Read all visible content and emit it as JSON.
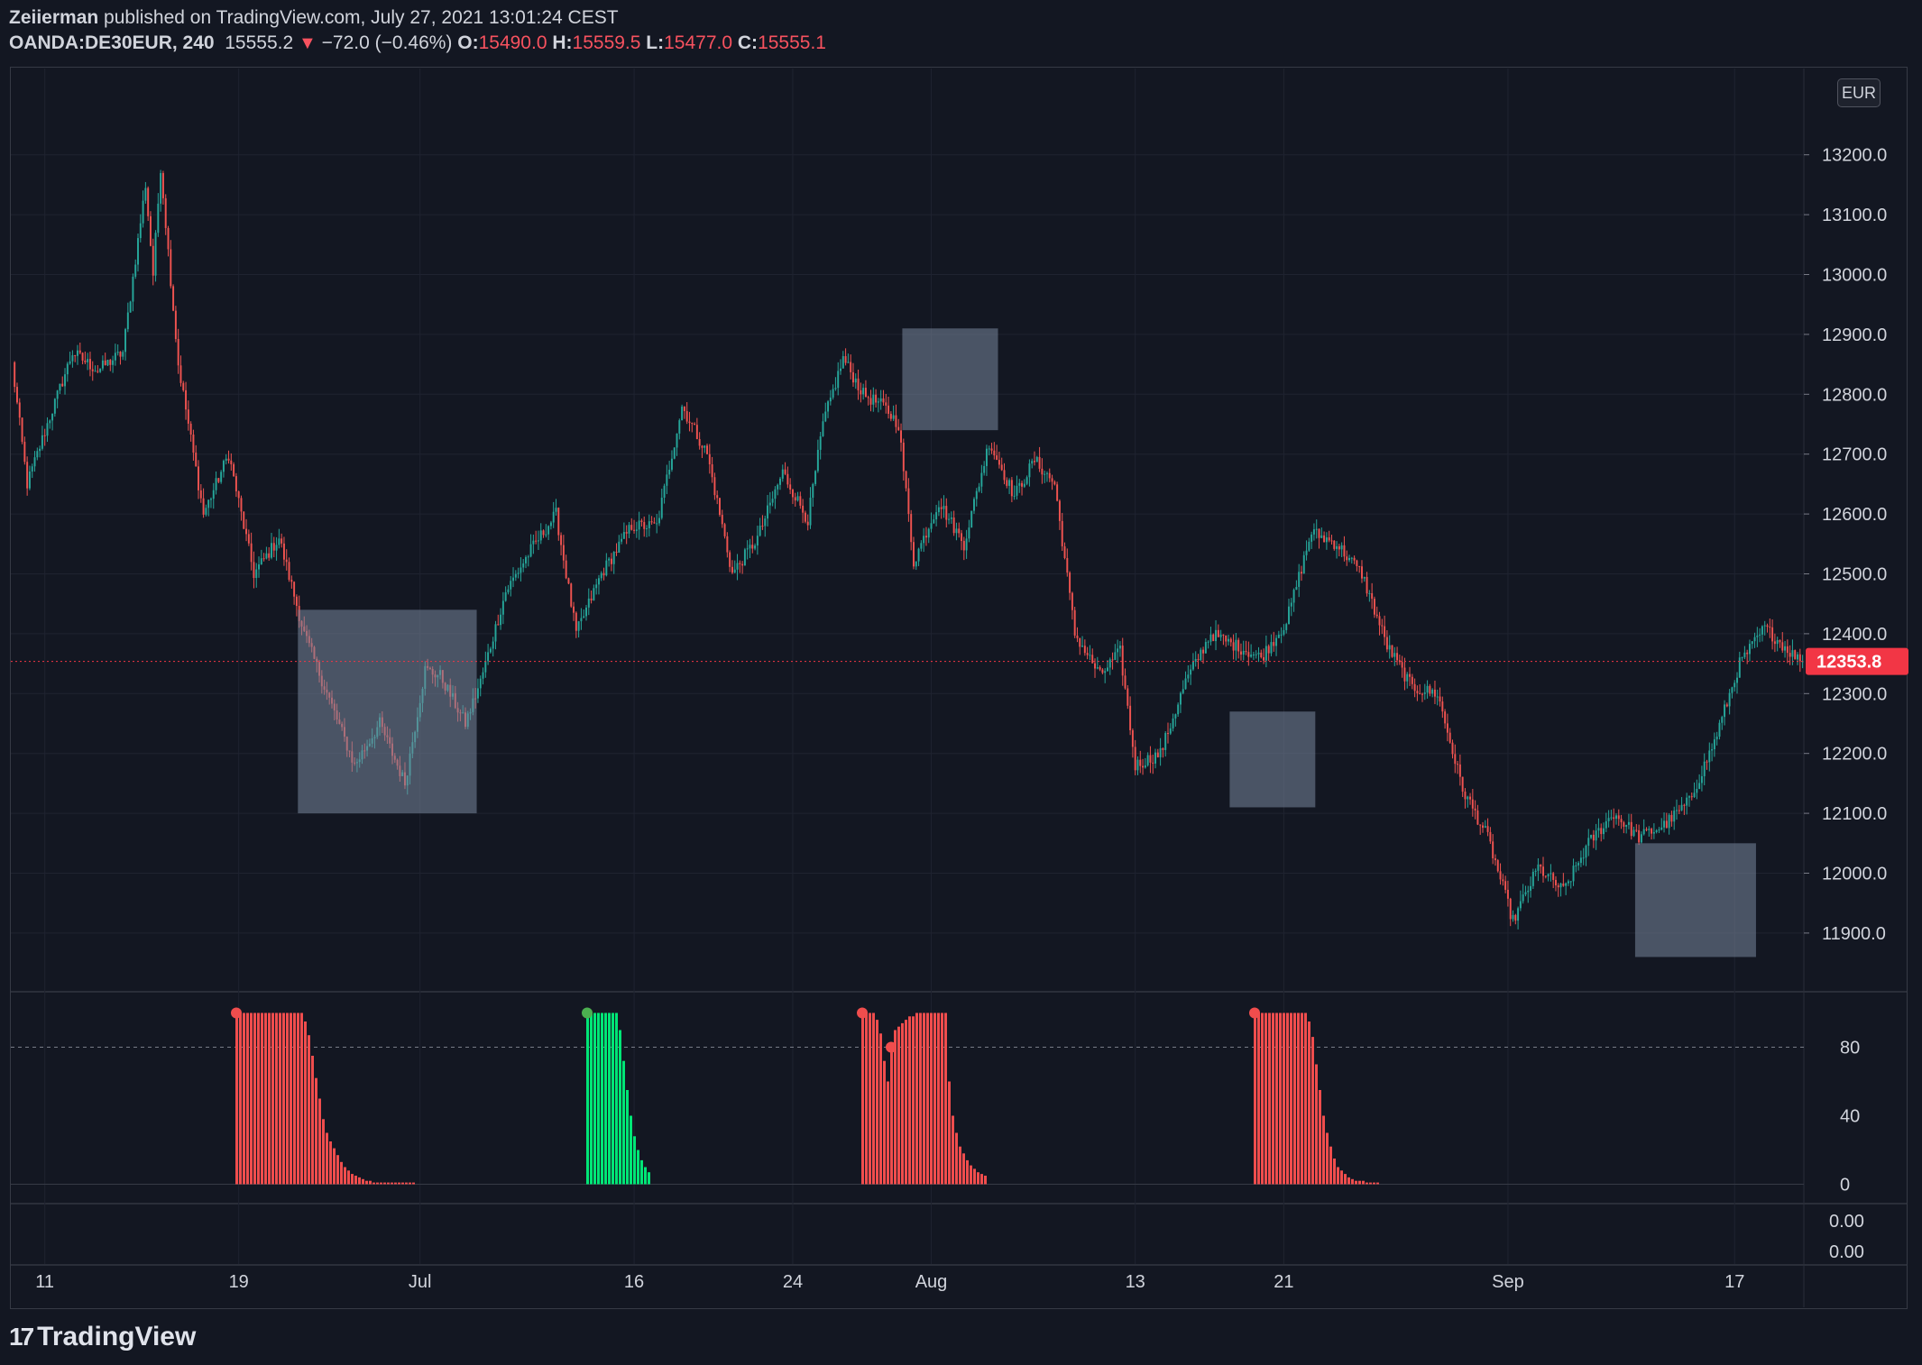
{
  "header": {
    "author": "Zeiierman",
    "published_text": " published on TradingView.com, July 27, 2021 13:01:24 CEST",
    "symbol": "OANDA:DE30EUR, 240",
    "last": "15555.2",
    "arrow": "▼",
    "change": "−72.0 (−0.46%)",
    "o_label": "O:",
    "o_val": "15490.0",
    "h_label": "H:",
    "h_val": "15559.5",
    "l_label": "L:",
    "l_val": "15477.0",
    "c_label": "C:",
    "c_val": "15555.1"
  },
  "brand": {
    "logo": "17",
    "name": "TradingView"
  },
  "currency": "EUR",
  "price_badge": "12353.8",
  "colors": {
    "up": "#26a69a",
    "down": "#ef5350",
    "osc_red": "#f04d4d",
    "osc_green": "#00e676",
    "box": "rgba(120,134,156,0.55)",
    "badge": "#f23645"
  },
  "chart_data": [
    {
      "type": "candlestick",
      "series": [
        {
          "name": "OANDA:DE30EUR, 240"
        }
      ],
      "y_ticks": [
        "13200.0",
        "13100.0",
        "13000.0",
        "12900.0",
        "12800.0",
        "12700.0",
        "12600.0",
        "12500.0",
        "12400.0",
        "12300.0",
        "12200.0",
        "12100.0",
        "12000.0",
        "11900.0"
      ],
      "ylim": [
        11810,
        13340
      ],
      "x_ticks": [
        "11",
        "19",
        "Jul",
        "16",
        "24",
        "Aug",
        "13",
        "21",
        "Sep",
        "17"
      ],
      "last_price": 12353.8,
      "path_anchors": [
        [
          0,
          12850
        ],
        [
          6,
          12650
        ],
        [
          14,
          12750
        ],
        [
          24,
          12870
        ],
        [
          34,
          12840
        ],
        [
          44,
          12870
        ],
        [
          53,
          13150
        ],
        [
          56,
          13000
        ],
        [
          59,
          13180
        ],
        [
          66,
          12850
        ],
        [
          76,
          12600
        ],
        [
          86,
          12700
        ],
        [
          96,
          12500
        ],
        [
          106,
          12560
        ],
        [
          116,
          12400
        ],
        [
          126,
          12290
        ],
        [
          136,
          12180
        ],
        [
          146,
          12250
        ],
        [
          156,
          12150
        ],
        [
          164,
          12340
        ],
        [
          170,
          12330
        ],
        [
          180,
          12250
        ],
        [
          186,
          12320
        ],
        [
          196,
          12470
        ],
        [
          206,
          12540
        ],
        [
          216,
          12600
        ],
        [
          224,
          12400
        ],
        [
          234,
          12500
        ],
        [
          246,
          12580
        ],
        [
          256,
          12580
        ],
        [
          266,
          12780
        ],
        [
          276,
          12700
        ],
        [
          286,
          12500
        ],
        [
          296,
          12560
        ],
        [
          306,
          12670
        ],
        [
          316,
          12590
        ],
        [
          322,
          12750
        ],
        [
          330,
          12860
        ],
        [
          338,
          12800
        ],
        [
          346,
          12780
        ],
        [
          352,
          12750
        ],
        [
          358,
          12520
        ],
        [
          368,
          12620
        ],
        [
          378,
          12550
        ],
        [
          388,
          12720
        ],
        [
          398,
          12630
        ],
        [
          406,
          12690
        ],
        [
          414,
          12650
        ],
        [
          422,
          12400
        ],
        [
          432,
          12330
        ],
        [
          440,
          12370
        ],
        [
          446,
          12180
        ],
        [
          456,
          12200
        ],
        [
          466,
          12320
        ],
        [
          476,
          12400
        ],
        [
          486,
          12380
        ],
        [
          496,
          12360
        ],
        [
          506,
          12420
        ],
        [
          516,
          12570
        ],
        [
          526,
          12550
        ],
        [
          536,
          12500
        ],
        [
          546,
          12380
        ],
        [
          556,
          12310
        ],
        [
          566,
          12300
        ],
        [
          576,
          12140
        ],
        [
          586,
          12060
        ],
        [
          596,
          11920
        ],
        [
          606,
          12010
        ],
        [
          616,
          11970
        ],
        [
          626,
          12050
        ],
        [
          636,
          12100
        ],
        [
          646,
          12060
        ],
        [
          656,
          12080
        ],
        [
          666,
          12120
        ],
        [
          676,
          12220
        ],
        [
          686,
          12350
        ],
        [
          696,
          12410
        ],
        [
          706,
          12370
        ],
        [
          710,
          12354
        ]
      ],
      "highlight_boxes": [
        [
          114,
          12440,
          12100
        ],
        [
          354,
          12910,
          12740
        ],
        [
          484,
          12270,
          12110
        ],
        [
          645,
          12050,
          11860
        ]
      ]
    },
    {
      "type": "bar",
      "y_ticks": [
        "80",
        "40",
        "0"
      ],
      "ylim": [
        0,
        100
      ],
      "threshold": 80,
      "groups": [
        {
          "color": "red",
          "values": [
            100,
            100,
            100,
            100,
            100,
            100,
            100,
            100,
            100,
            100,
            100,
            100,
            100,
            100,
            100,
            100,
            100,
            100,
            100,
            95,
            87,
            75,
            62,
            50,
            38,
            30,
            25,
            21,
            17,
            13,
            10,
            8,
            6,
            5,
            4,
            3,
            2,
            2,
            1,
            1,
            1,
            1,
            1,
            1,
            1,
            1,
            1,
            1,
            1,
            1
          ]
        },
        {
          "color": "green",
          "values": [
            100,
            100,
            100,
            100,
            100,
            100,
            100,
            100,
            100,
            90,
            72,
            55,
            40,
            28,
            20,
            14,
            10,
            7
          ]
        },
        {
          "color": "red",
          "values": [
            100,
            100,
            100,
            100,
            96,
            88,
            72,
            60,
            80,
            90,
            92,
            94,
            96,
            98,
            98,
            100,
            100,
            100,
            100,
            100,
            100,
            100,
            100,
            100,
            60,
            40,
            30,
            22,
            18,
            14,
            11,
            9,
            7,
            6,
            5
          ]
        },
        {
          "color": "red",
          "values": [
            100,
            100,
            100,
            100,
            100,
            100,
            100,
            100,
            100,
            100,
            100,
            100,
            100,
            100,
            100,
            95,
            86,
            70,
            55,
            40,
            30,
            22,
            15,
            10,
            8,
            6,
            4,
            3,
            2,
            2,
            2,
            1,
            1,
            1,
            1
          ]
        }
      ]
    },
    {
      "type": "line",
      "y_ticks": [
        "0.00",
        "0.00"
      ]
    }
  ]
}
